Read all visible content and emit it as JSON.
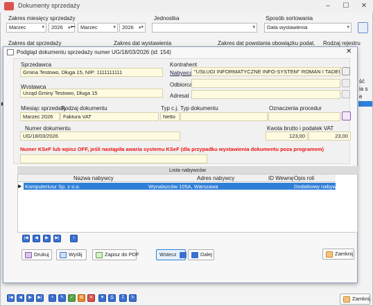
{
  "window": {
    "title": "Dokumenty sprzedaży"
  },
  "filters": {
    "zakres_label": "Zakres miesięcy sprzedaży",
    "from_month": "Marzec",
    "from_year": "2026",
    "dash": "–",
    "to_month": "Marzec",
    "to_year": "2026",
    "jednostka_label": "Jednostka",
    "jednostka_value": "",
    "sort_label": "Sposób sortowania",
    "sort_value": "Data wystawienia",
    "zakres_dat_sprzedazy": "Zakres dat sprzedaży",
    "zakres_dat_wystawienia": "Zakres dat wystawienia",
    "zakres_dat_powstania": "Zakres dat powstania obowiązku podat.",
    "rodzaj_rejestru": "Rodzaj rejestru"
  },
  "bg_right": [
    "ść",
    "ia s",
    "e"
  ],
  "dialog": {
    "title": "Podgląd dokumentu sprzedaży numer UG/18/03/2026 (id: 154)",
    "sprzedawca_label": "Sprzedawca",
    "sprzedawca": "Gmina Testowo, Długa 15, NIP: 1111111111",
    "wystawca_label": "Wystawca",
    "wystawca": "Urząd Gminy Testowo, Długa 15",
    "kontrahent_label": "Kontrahent",
    "nabywca_label": "Nabywca",
    "nabywca": "\"USŁUGI INFORMATYCZNE INFO-SYSTEM\" ROMAN I TADEUSZ GROSZ",
    "odbiorca_label": "Odbiorca",
    "odbiorca": "",
    "adresat_label": "Adresat",
    "adresat": "",
    "miesiac_label": "Miesiąc sprzedaży",
    "miesiac": "Marzec 2026",
    "rodzaj_label": "Rodzaj dokumentu",
    "rodzaj": "Faktura VAT",
    "typcj_label": "Typ c.j.",
    "typcj": "Netto",
    "typdok_label": "Typ dokumentu",
    "typdok": "",
    "ozn_label": "Oznaczenia procedur",
    "ozn": "",
    "numer_label": "Numer dokumentu",
    "numer": "UG/18/03/2026",
    "kwota_label": "Kwota brutto i podatek VAT",
    "brutto": "123,00",
    "vat": "23,00",
    "ksef_warning": "Numer KSeF lub wpisz OFF, jeśli nastąpiła awaria systemu KSeF (dla przypadku wystawienia dokumentu poza programem)",
    "ksef_value": ""
  },
  "lista": {
    "title": "Lista nabywców",
    "columns": [
      "Nazwa nabywcy",
      "Adres nabywcy",
      "ID Wewnę",
      "Opis roli"
    ],
    "rows": [
      [
        "Komputeriusz Sp. z o.o.",
        "Wynalazców 105A, Warszawa",
        "",
        "Dodatkowy nabywca"
      ]
    ]
  },
  "buttons": {
    "drukuj": "Drukuj",
    "wyslij": "Wyślij",
    "pdf": "Zapisz do PDF",
    "wstecz": "Wstecz",
    "dalej": "Dalej",
    "zamknij": "Zamknij",
    "zamknij_outer": "Zamknij"
  },
  "colors": {
    "accent": "#2f7fd8",
    "warning": "#e11111",
    "yellow_field": "#fffbe0"
  }
}
